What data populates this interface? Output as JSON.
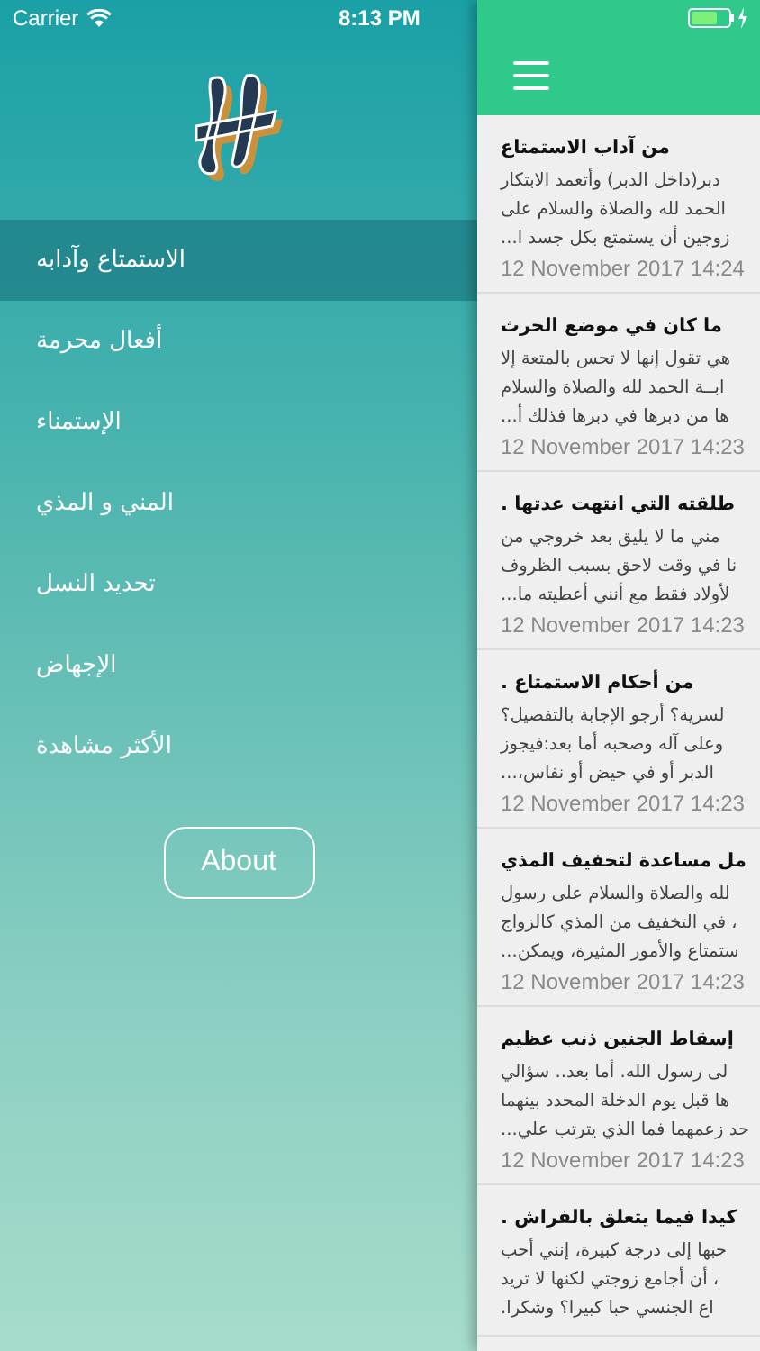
{
  "status_bar": {
    "carrier": "Carrier",
    "time": "8:13 PM"
  },
  "sidebar": {
    "items": [
      {
        "label": "الاستمتاع وآدابه",
        "selected": true
      },
      {
        "label": "أفعال محرمة",
        "selected": false
      },
      {
        "label": "الإستمناء",
        "selected": false
      },
      {
        "label": "المني و المذي",
        "selected": false
      },
      {
        "label": "تحديد النسل",
        "selected": false
      },
      {
        "label": "الإجهاض",
        "selected": false
      },
      {
        "label": "الأكثر مشاهدة",
        "selected": false
      }
    ],
    "about_button": "About"
  },
  "articles": [
    {
      "title": "من آداب الاستمتاع",
      "lines": [
        "دبر(داخل الدبر) وأتعمد الابتكار",
        "الحمد لله والصلاة والسلام على",
        "زوجين أن يستمتع بكل جسد ا..."
      ],
      "date": "12 November 2017 14:24"
    },
    {
      "title": "ما كان في موضع الحرث",
      "lines": [
        "هي تقول إنها لا تحس بالمتعة إلا",
        "ابــة  الحمد لله والصلاة والسلام",
        "ها من دبرها في دبرها فذلك أ..."
      ],
      "date": "12 November 2017 14:23"
    },
    {
      "title": "طلقته التي انتهت عدتها .",
      "lines": [
        "مني ما لا يليق بعد خروجي من",
        "نا في وقت لاحق بسبب الظروف",
        "لأولاد فقط مع أنني أعطيته ما..."
      ],
      "date": "12 November 2017 14:23"
    },
    {
      "title": "من أحكام الاستمتاع .",
      "lines": [
        "لسرية؟ أرجو الإجابة بالتفصيل؟",
        "وعلى آله وصحبه أما بعد:فيجوز",
        "الدبر أو في حيض أو نفاس،..."
      ],
      "date": "12 November 2017 14:23"
    },
    {
      "title": "مل مساعدة لتخفيف المذي",
      "lines": [
        "لله والصلاة والسلام على رسول",
        "، في التخفيف من المذي كالزواج",
        "ستمتاع والأمور المثيرة، ويمكن..."
      ],
      "date": "12 November 2017 14:23"
    },
    {
      "title": "إسقاط الجنين ذنب عظيم",
      "lines": [
        "لى رسول الله. أما بعد.. سؤالي",
        "ها قبل يوم الدخلة المحدد بينهما",
        "حد زعمهما فما الذي يترتب علي..."
      ],
      "date": "12 November 2017 14:23"
    },
    {
      "title": "كيدا فيما يتعلق بالفراش .",
      "lines": [
        "حبها إلى درجة كبيرة، إنني أحب",
        "، أن أجامع زوجتي لكنها لا تريد",
        "اع الجنسي حبا كبيرا؟ وشكرا."
      ]
    }
  ]
}
